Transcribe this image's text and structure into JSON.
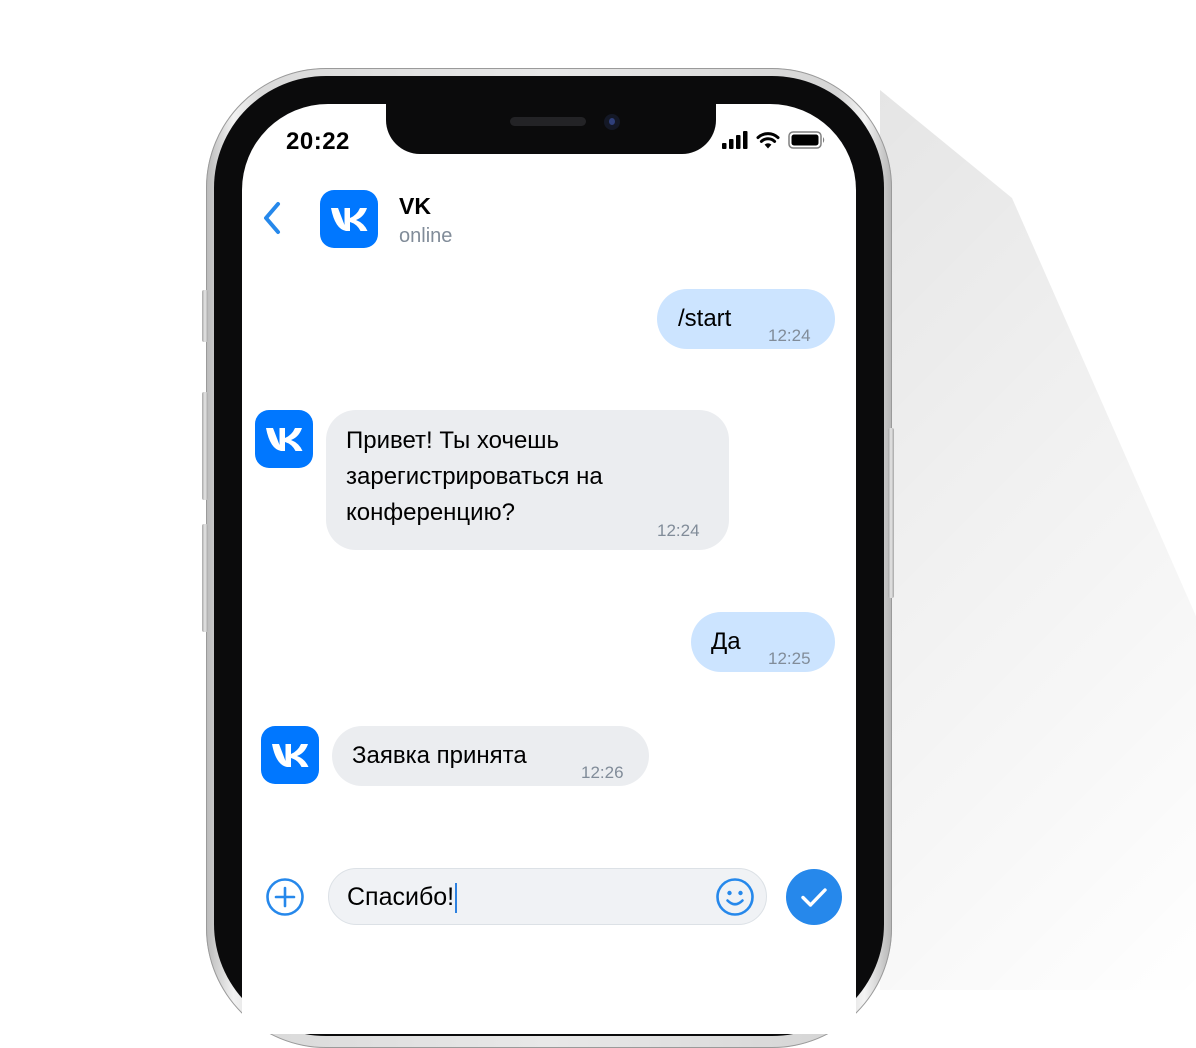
{
  "status_bar": {
    "time": "20:22"
  },
  "header": {
    "name": "VK",
    "status": "online"
  },
  "messages": [
    {
      "direction": "out",
      "text": "/start",
      "time": "12:24"
    },
    {
      "direction": "in",
      "lines": [
        "Привет! Ты хочешь",
        "зарегистрироваться на",
        "конференцию?"
      ],
      "time": "12:24"
    },
    {
      "direction": "out",
      "text": "Да",
      "time": "12:25"
    },
    {
      "direction": "in",
      "text": "Заявка принята",
      "time": "12:26"
    }
  ],
  "composer": {
    "value": "Спасибо!"
  },
  "icons": {
    "back": "chevron-left-icon",
    "avatar": "vk-logo-icon",
    "add": "plus-circle-icon",
    "emoji": "smile-icon",
    "send": "check-icon",
    "signal": "cellular-signal-icon",
    "wifi": "wifi-icon",
    "battery": "battery-icon"
  },
  "colors": {
    "accent": "#2688eb",
    "vk_brand": "#0077ff",
    "outgoing_bubble": "#cce4ff",
    "incoming_bubble": "#ebedf0",
    "secondary_text": "#818c99"
  }
}
